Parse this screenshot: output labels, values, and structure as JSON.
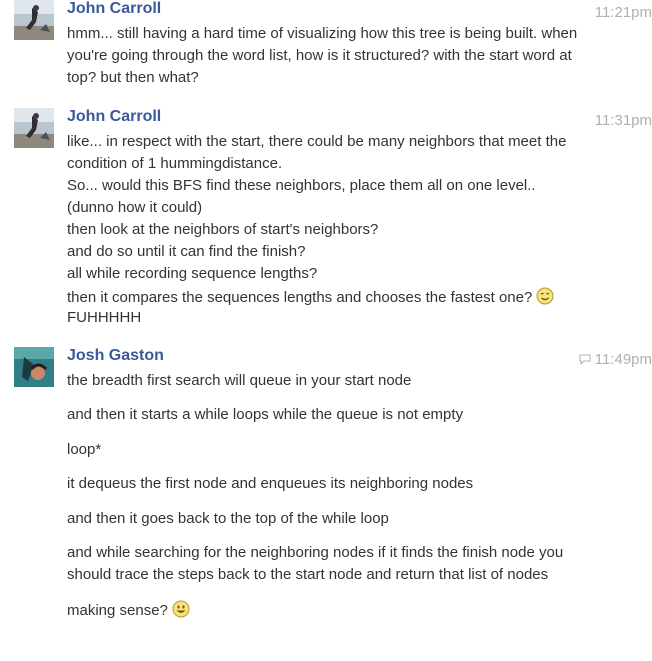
{
  "messages": [
    {
      "sender": "John Carroll",
      "time": "11:21pm",
      "avatar_icon": "beach-photo-avatar",
      "lines": [
        "hmm... still having a hard time of visualizing how this tree is being built. when",
        "you're going through the word list, how is it structured? with the start word at",
        "top? but then what?"
      ]
    },
    {
      "sender": "John Carroll",
      "time": "11:31pm",
      "avatar_icon": "beach-photo-avatar",
      "lines": [
        "like... in respect with the start, there could be many neighbors that meet the",
        "condition of 1 hummingdistance.",
        "So... would this BFS find these neighbors, place them all on one level..",
        "(dunno how it could)",
        "then look at the neighbors of start's neighbors?",
        "and do so until it can find the finish?",
        "all while recording sequence lengths?",
        "then it compares the sequences lengths and chooses the fastest one?",
        "FUHHHHH"
      ]
    },
    {
      "sender": "Josh Gaston",
      "time": "11:49pm",
      "avatar_icon": "underwater-photo-avatar",
      "lines": [
        "the breadth first search will queue in your start node",
        "and then it starts a while loops while the queue is not empty",
        "loop*",
        "it dequeus the first node and enqueues its neighboring nodes",
        "and then it goes back to the top of the while loop",
        "and while searching for the neighboring nodes if it finds the finish node you",
        "should trace the steps back to the start node and return that list of nodes",
        "making sense?"
      ]
    }
  ],
  "icons": {
    "smirk_emoji": "smirk-emoji-icon",
    "smile_emoji": "smile-emoji-icon",
    "seen": "seen-speech-bubble-icon"
  },
  "colors": {
    "sender_name": "#3b5998",
    "timestamp": "#b0b0b0",
    "message_text": "#333333"
  }
}
